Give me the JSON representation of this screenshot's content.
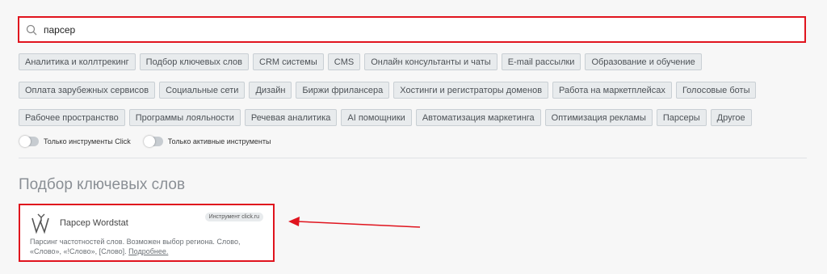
{
  "search": {
    "value": "парсер",
    "placeholder": ""
  },
  "tags_row1": [
    "Аналитика и коллтрекинг",
    "Подбор ключевых слов",
    "CRM системы",
    "CMS",
    "Онлайн консультанты и чаты",
    "E-mail рассылки",
    "Образование и обучение"
  ],
  "tags_row2": [
    "Оплата зарубежных сервисов",
    "Социальные сети",
    "Дизайн",
    "Биржи фрилансера",
    "Хостинги и регистраторы доменов",
    "Работа на маркетплейсах",
    "Голосовые боты"
  ],
  "tags_row3": [
    "Рабочее пространство",
    "Программы лояльности",
    "Речевая аналитика",
    "AI помощники",
    "Автоматизация маркетинга",
    "Оптимизация рекламы",
    "Парсеры",
    "Другое"
  ],
  "toggles": {
    "click_only": "Только инструменты Click",
    "active_only": "Только активные инструменты"
  },
  "section": {
    "title": "Подбор ключевых слов"
  },
  "card": {
    "title": "Парсер Wordstat",
    "badge": "Инструмент click.ru",
    "description": "Парсинг частотностей слов. Возможен выбор региона. Слово, «Слово», «!Слово», [Слово].",
    "more": "Подробнее."
  },
  "colors": {
    "highlight": "#e0141e",
    "tag_bg": "#e8ebed"
  }
}
